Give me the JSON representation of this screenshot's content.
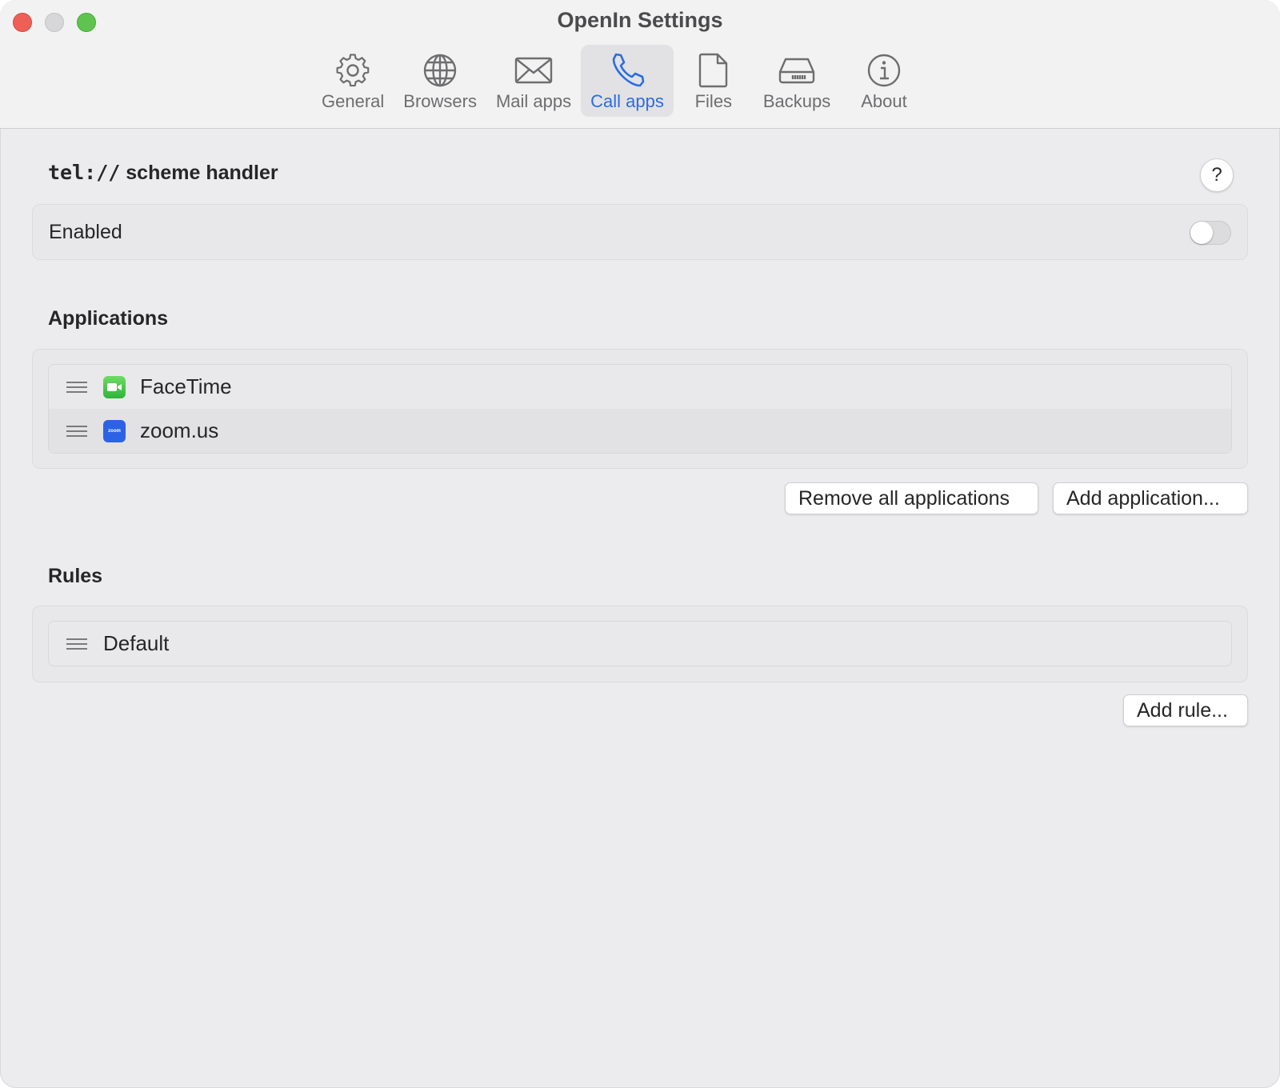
{
  "window": {
    "title": "OpenIn Settings"
  },
  "tabs": [
    {
      "label": "General",
      "icon": "gear-icon",
      "active": false
    },
    {
      "label": "Browsers",
      "icon": "globe-icon",
      "active": false
    },
    {
      "label": "Mail apps",
      "icon": "envelope-icon",
      "active": false
    },
    {
      "label": "Call apps",
      "icon": "phone-icon",
      "active": true
    },
    {
      "label": "Files",
      "icon": "document-icon",
      "active": false
    },
    {
      "label": "Backups",
      "icon": "drive-icon",
      "active": false
    },
    {
      "label": "About",
      "icon": "info-icon",
      "active": false
    }
  ],
  "handler": {
    "scheme": "tel://",
    "title_suffix": " scheme handler",
    "help_label": "?",
    "enabled_label": "Enabled",
    "enabled": false
  },
  "applications": {
    "title": "Applications",
    "items": [
      {
        "name": "FaceTime",
        "icon": "facetime-icon"
      },
      {
        "name": "zoom.us",
        "icon": "zoom-icon",
        "icon_text": "zoom"
      }
    ],
    "remove_all_label": "Remove all applications",
    "add_label": "Add application..."
  },
  "rules": {
    "title": "Rules",
    "items": [
      {
        "name": "Default"
      }
    ],
    "add_label": "Add rule..."
  },
  "colors": {
    "accent": "#2b6de3",
    "background": "#ececee",
    "close": "#ee5f57",
    "maximize": "#5ec44f"
  }
}
